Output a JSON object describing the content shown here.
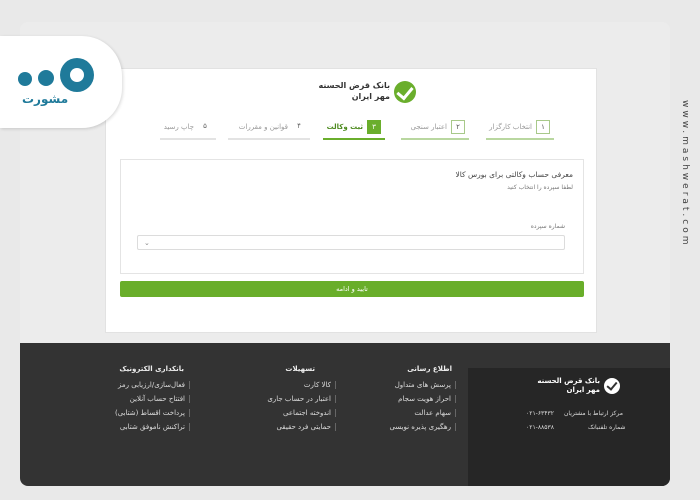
{
  "brand": {
    "logo_line1": "بانک قرض الحسنه",
    "logo_line2": "مهر ایران",
    "accent": "#6aae2c"
  },
  "steps": [
    {
      "number": "۱",
      "label": "انتخاب کارگزار",
      "state": "done"
    },
    {
      "number": "۲",
      "label": "اعتبار سنجی",
      "state": "done"
    },
    {
      "number": "۳",
      "label": "ثبت وکالت",
      "state": "active"
    },
    {
      "number": "۴",
      "label": "قوانین و مقررات",
      "state": "pending"
    },
    {
      "number": "۵",
      "label": "چاپ رسید",
      "state": "pending"
    }
  ],
  "form": {
    "title": "معرفی حساب وکالتی برای بورس کالا",
    "hint": "لطفا سپرده را انتخاب کنید",
    "field_label": "شماره سپرده",
    "select_value": "",
    "chevron_icon": "chevron-down-icon"
  },
  "confirm_button": "تایید و ادامه",
  "footer": {
    "logo_line1": "بانک قرض الحسنه",
    "logo_line2": "مهر ایران",
    "contact": [
      {
        "label": "مرکز ارتباط با مشتریان",
        "value": "۰۲۱-۶۳۴۳۲"
      },
      {
        "label": "شماره تلفنبانک",
        "value": "۰۲۱-۸۸۵۳۸"
      }
    ],
    "columns": [
      {
        "title": "اطلاع رسانی",
        "items": [
          "پرسش های متداول",
          "احراز هویت سجام",
          "سهام عدالت",
          "رهگیری پذیره نویسی"
        ]
      },
      {
        "title": "تسهیلات",
        "items": [
          "کالا کارت",
          "اعتبار در حساب جاری",
          "اندوخته اجتماعی",
          "حمایتی فرد حقیقی"
        ]
      },
      {
        "title": "بانکداری الکترونیک",
        "items": [
          "فعال‌سازی/ارزیابی رمز",
          "افتتاح حساب آنلاین",
          "پرداخت اقساط (شتابی)",
          "تراکنش ناموفق شتابی"
        ]
      }
    ]
  },
  "overlay": {
    "brand_word": "مشورت",
    "watermark": "www.mashwerat.com"
  }
}
